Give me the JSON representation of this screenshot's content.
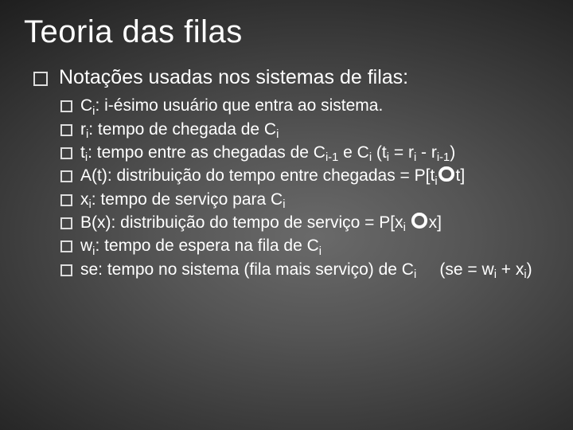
{
  "title": "Teoria das filas",
  "heading": "Notações usadas nos sistemas de filas:",
  "items": [
    {
      "html": "C<sub>i</sub>: i-ésimo usuário que entra ao sistema."
    },
    {
      "html": "r<sub>i</sub>: tempo de chegada de C<sub>i</sub>"
    },
    {
      "html": "t<sub>i</sub>: tempo entre as chegadas de C<sub>i-1</sub> e C<sub>i</sub> (t<sub>i</sub> = r<sub>i</sub> - r<sub>i-1</sub>)"
    },
    {
      "html": "A(t): distribuição do tempo entre chegadas = P[t<sub>i</sub><span class=\"ring\"></span>t]"
    },
    {
      "html": "x<sub>i</sub>: tempo de serviço para C<sub>i</sub>"
    },
    {
      "html": "B(x): distribuição do tempo de serviço = P[x<sub>i</sub> <span class=\"ring\"></span>x]"
    },
    {
      "html": "w<sub>i</sub>: tempo de espera na fila de C<sub>i</sub>"
    },
    {
      "html": "se: tempo no sistema (fila mais serviço) de C<sub>i</sub> &nbsp;&nbsp;&nbsp;&nbsp;(se = w<sub>i</sub> + x<sub>i</sub>)"
    }
  ]
}
